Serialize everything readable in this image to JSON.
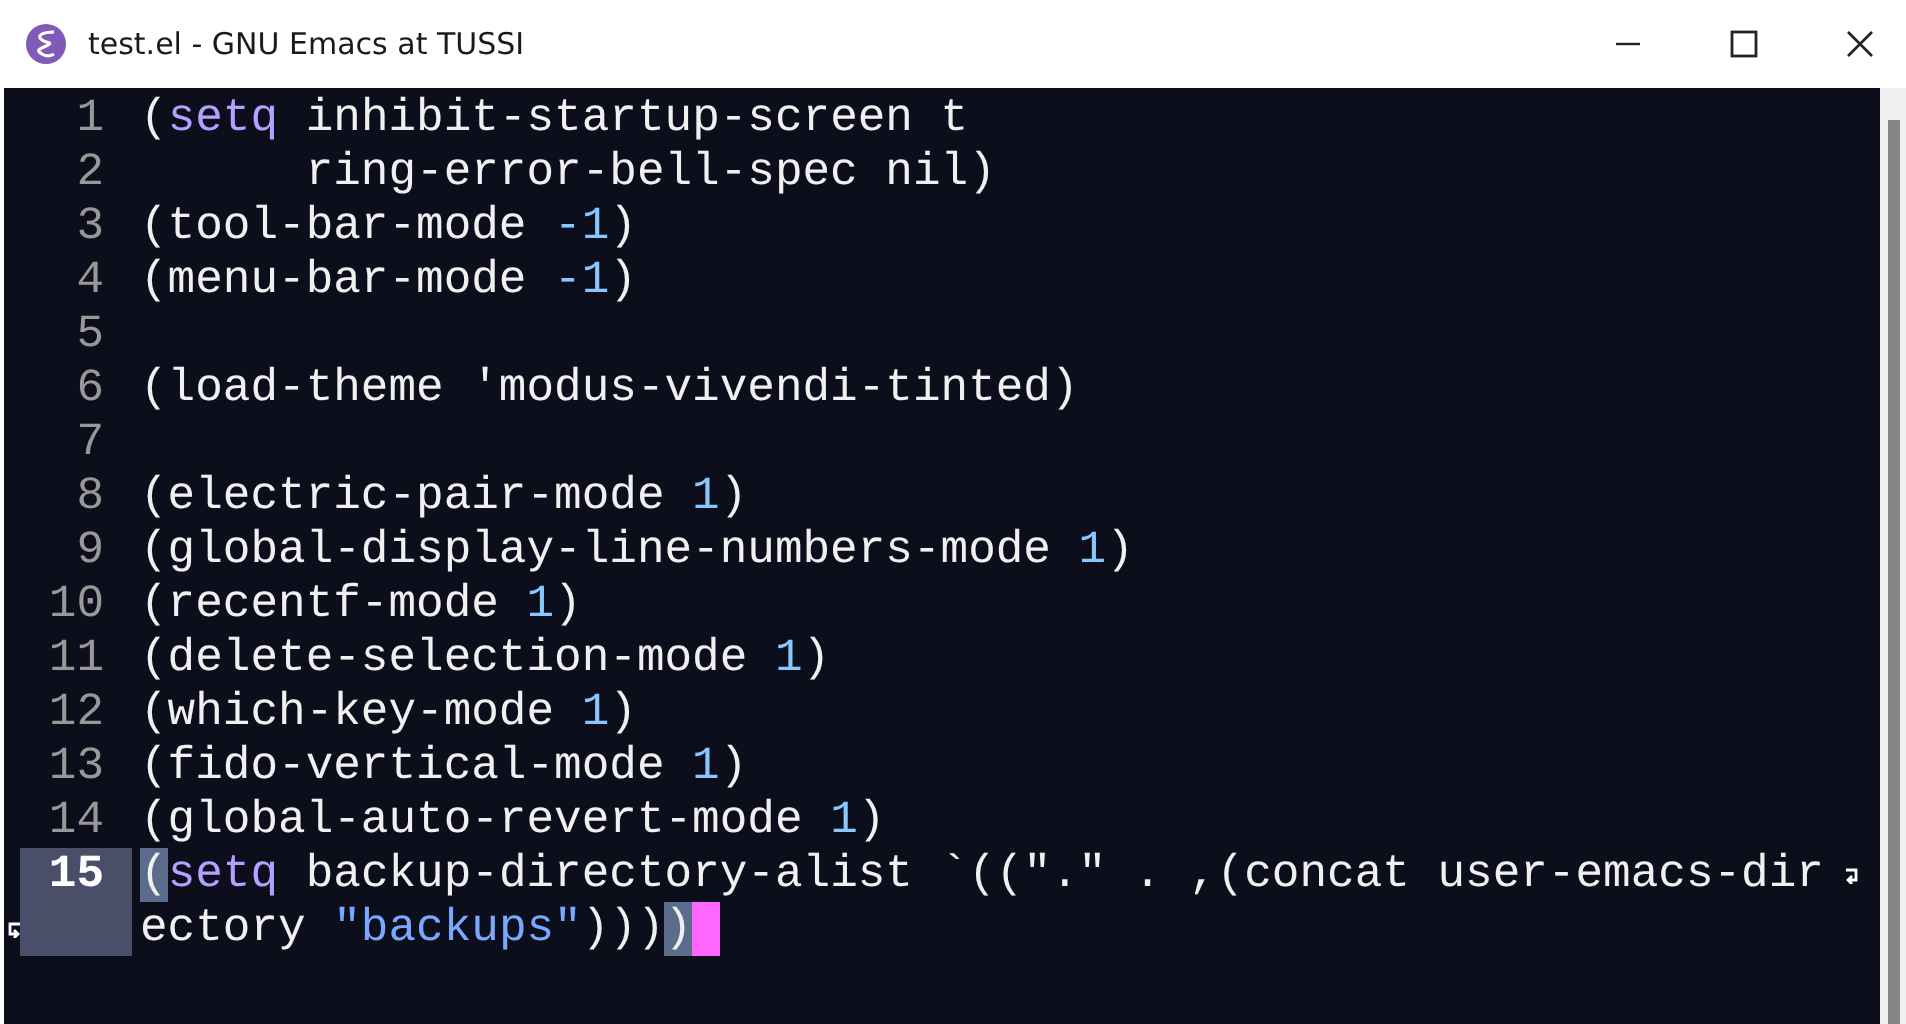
{
  "window": {
    "title": "test.el - GNU Emacs at TUSSI"
  },
  "lines": [
    {
      "number": "1",
      "selected": false,
      "segments": [
        {
          "kind": "paren",
          "text": "("
        },
        {
          "kind": "keyword",
          "text": "setq"
        },
        {
          "kind": "text",
          "text": " inhibit-startup-screen t"
        }
      ]
    },
    {
      "number": "2",
      "selected": false,
      "segments": [
        {
          "kind": "text",
          "text": "      ring-error-bell-spec nil)"
        }
      ]
    },
    {
      "number": "3",
      "selected": false,
      "segments": [
        {
          "kind": "text",
          "text": "(tool-bar-mode "
        },
        {
          "kind": "number",
          "text": "-1"
        },
        {
          "kind": "text",
          "text": ")"
        }
      ]
    },
    {
      "number": "4",
      "selected": false,
      "segments": [
        {
          "kind": "text",
          "text": "(menu-bar-mode "
        },
        {
          "kind": "number",
          "text": "-1"
        },
        {
          "kind": "text",
          "text": ")"
        }
      ]
    },
    {
      "number": "5",
      "selected": false
    },
    {
      "number": "6",
      "selected": false,
      "segments": [
        {
          "kind": "text",
          "text": "(load-theme 'modus-vivendi-tinted)"
        }
      ]
    },
    {
      "number": "7",
      "selected": false
    },
    {
      "number": "8",
      "selected": false,
      "segments": [
        {
          "kind": "text",
          "text": "(electric-pair-mode "
        },
        {
          "kind": "number",
          "text": "1"
        },
        {
          "kind": "text",
          "text": ")"
        }
      ]
    },
    {
      "number": "9",
      "selected": false,
      "segments": [
        {
          "kind": "text",
          "text": "(global-display-line-numbers-mode "
        },
        {
          "kind": "number",
          "text": "1"
        },
        {
          "kind": "text",
          "text": ")"
        }
      ]
    },
    {
      "number": "10",
      "selected": false,
      "segments": [
        {
          "kind": "text",
          "text": "(recentf-mode "
        },
        {
          "kind": "number",
          "text": "1"
        },
        {
          "kind": "text",
          "text": ")"
        }
      ]
    },
    {
      "number": "11",
      "selected": false,
      "segments": [
        {
          "kind": "text",
          "text": "(delete-selection-mode "
        },
        {
          "kind": "number",
          "text": "1"
        },
        {
          "kind": "text",
          "text": ")"
        }
      ]
    },
    {
      "number": "12",
      "selected": false,
      "segments": [
        {
          "kind": "text",
          "text": "(which-key-mode "
        },
        {
          "kind": "number",
          "text": "1"
        },
        {
          "kind": "text",
          "text": ")"
        }
      ]
    },
    {
      "number": "13",
      "selected": false,
      "segments": [
        {
          "kind": "text",
          "text": "(fido-vertical-mode "
        },
        {
          "kind": "number",
          "text": "1"
        },
        {
          "kind": "text",
          "text": ")"
        }
      ]
    },
    {
      "number": "14",
      "selected": false,
      "segments": [
        {
          "kind": "text",
          "text": "(global-auto-revert-mode "
        },
        {
          "kind": "number",
          "text": "1"
        },
        {
          "kind": "text",
          "text": ")"
        }
      ]
    },
    {
      "number": "15",
      "selected": true,
      "segments": [
        {
          "kind": "match",
          "text": "("
        },
        {
          "kind": "keyword",
          "text": "setq"
        },
        {
          "kind": "text",
          "text": " backup-directory-alist `((\".\" . ,(concat user-emacs-dir"
        }
      ],
      "continuation": [
        {
          "kind": "text",
          "text": "ectory "
        },
        {
          "kind": "string",
          "text": "\"backups\""
        },
        {
          "kind": "text",
          "text": ")))"
        },
        {
          "kind": "match",
          "text": ")"
        },
        {
          "kind": "cursor"
        }
      ]
    }
  ]
}
